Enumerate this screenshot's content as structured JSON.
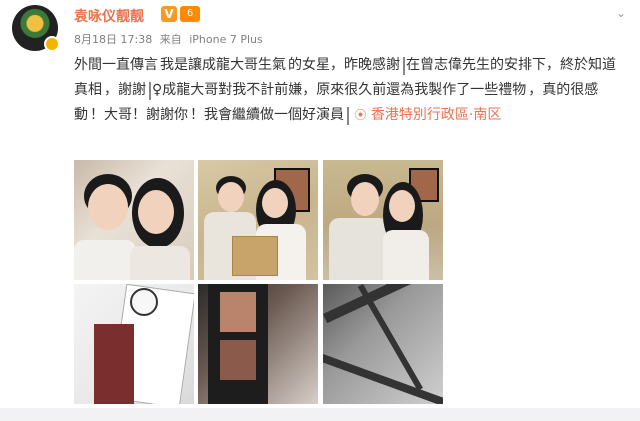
{
  "post": {
    "username": "袁咏仪靓靓",
    "vip_badge": "V",
    "level_badge": "6",
    "dropdown": "⌄",
    "date": "8月18日 17:38",
    "source_prefix": "来自",
    "source_device": "iPhone 7 Plus",
    "text": {
      "seg1": "外間一直傳言",
      "seg2": "我是讓成龍大哥生氣",
      "seg3": "的女星，昨晚感謝",
      "seg4": "在曾志偉先生的安排下，終於知道真相",
      "seg5": "，謝謝",
      "seg6": "♀成龍大哥對我不計前嫌，原來很久前還為我製作了一些禮物",
      "seg7": "，真的很感動",
      "seg8": "！大哥！謝謝你",
      "seg9": "！我會繼續做一個好演員"
    },
    "location_pin": "⦿",
    "location": "香港特別行政區·南区"
  },
  "icons": {
    "avatar": "avatar-image",
    "dropdown": "chevron-down-icon",
    "location": "location-pin-icon"
  },
  "colors": {
    "username": "#eb7350",
    "meta": "#808080",
    "text": "#333333",
    "location": "#eb7350",
    "divider": "#f2f2f5"
  }
}
